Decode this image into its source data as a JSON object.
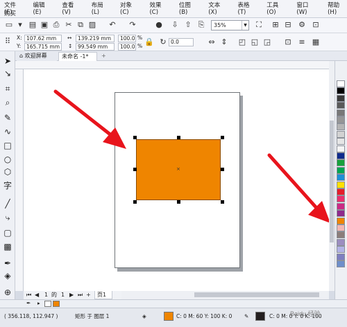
{
  "menu": {
    "row1": [
      "文件(F)",
      "编辑(E)",
      "查看(V)",
      "布局(L)",
      "对象(C)",
      "效果(C)",
      "位图(B)",
      "文本(X)",
      "表格(T)",
      "工具(O)",
      "窗口(W)",
      "帮助(H)"
    ],
    "row2": [
      "购买"
    ]
  },
  "toolbar": {
    "zoom_value": "35%",
    "icons": [
      "new-icon",
      "open-icon",
      "save-icon",
      "print-icon",
      "cut-icon",
      "copy-icon",
      "paste-icon",
      "undo-icon",
      "redo-icon",
      "search-icon",
      "import-icon",
      "export-icon",
      "publish-pdf-icon",
      "fullscreen-icon"
    ]
  },
  "property_bar": {
    "x_label": "X:",
    "x_value": "107.62 mm",
    "y_label": "Y:",
    "y_value": "165.715 mm",
    "width_value": "139.219 mm",
    "height_value": "99.549 mm",
    "scale_x": "100.0",
    "scale_y": "100.0",
    "percent": "%",
    "rotation": "0.0"
  },
  "tabs": {
    "home": "欢迎屏幕",
    "document": "未命名 -1*",
    "add": "+"
  },
  "page_nav": {
    "current": "1",
    "of": "的",
    "total": "1",
    "page_tab": "页1"
  },
  "palette": {
    "colors": [
      "#ffffff",
      "#000000",
      "#3b3b3b",
      "#5a5a5a",
      "#787878",
      "#969696",
      "#b4b4b4",
      "#d2d2d2",
      "#e6e6e6",
      "#f5f5f5",
      "#0f2a8c",
      "#17a13c",
      "#00a651",
      "#1e90d6",
      "#ffe000",
      "#e51d2a",
      "#ea2f6e",
      "#cc2a85",
      "#8f2a8c",
      "#ef8500",
      "#f4b7b2",
      "#8b7d7a",
      "#9c8ec0",
      "#b3b3e6",
      "#7f7fc0",
      "#6f8fca"
    ],
    "selected": "#ef8500"
  },
  "status": {
    "coords": "( 356.118, 112.947 )",
    "object_info": "矩形 于 图层 1",
    "fill_color": "#ef8500",
    "fill_cmyk": "C: 0 M: 60 Y: 100 K: 0",
    "outline_color": "#231f20",
    "outline_cmyk": "C: 0 M: 0 Y: 0 K: 100"
  },
  "watermark": "Baidu 经验"
}
